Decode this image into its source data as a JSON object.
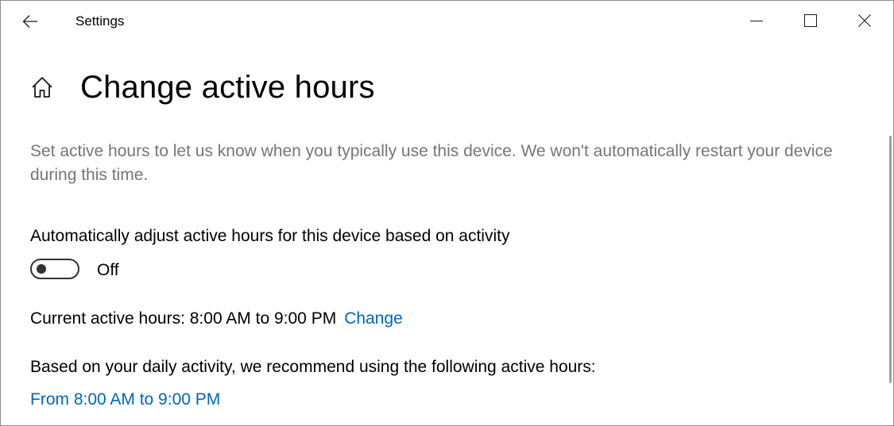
{
  "window": {
    "title": "Settings"
  },
  "controls": {
    "back_icon": "arrow-left",
    "minimize_icon": "minimize",
    "maximize_icon": "maximize",
    "close_icon": "close"
  },
  "header": {
    "home_icon": "home",
    "title": "Change active hours"
  },
  "main": {
    "description": "Set active hours to let us know when you typically use this device. We won't automatically restart your device during this time.",
    "auto_adjust_label": "Automatically adjust active hours for this device based on activity",
    "auto_adjust_state": "Off",
    "current_hours_text": "Current active hours: 8:00 AM to 9:00 PM",
    "change_link": "Change",
    "recommend_text": "Based on your daily activity, we recommend using the following active hours:",
    "recommend_link": "From 8:00 AM to 9:00 PM"
  },
  "colors": {
    "link": "#0067b8",
    "description": "#767676",
    "toggle_off": "#333333"
  }
}
